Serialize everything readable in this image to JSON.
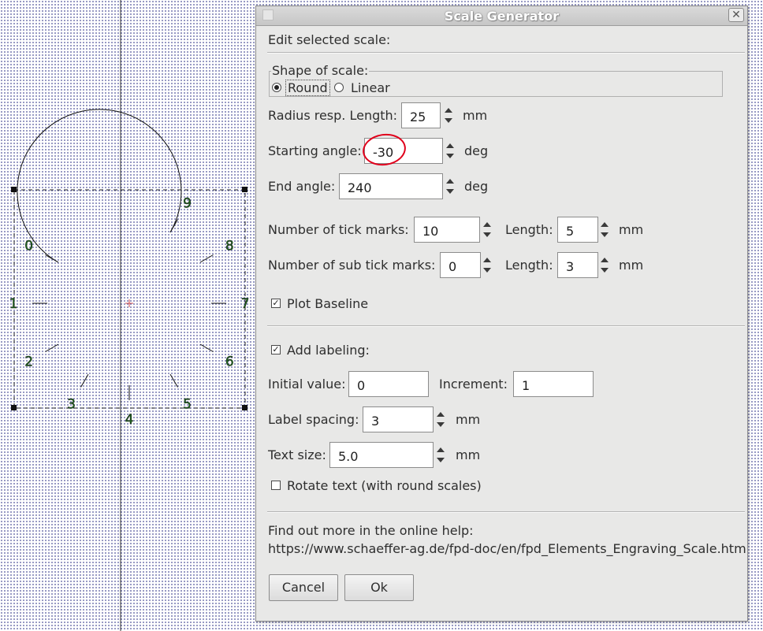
{
  "dialog": {
    "title": "Scale Generator",
    "heading": "Edit selected scale:",
    "shape": {
      "group_label": "Shape of scale:",
      "options": [
        "Round",
        "Linear"
      ],
      "selected": "Round"
    },
    "radius": {
      "label": "Radius resp. Length:",
      "value": "25",
      "unit": "mm"
    },
    "start_angle": {
      "label": "Starting angle:",
      "value": "-30",
      "unit": "deg"
    },
    "end_angle": {
      "label": "End angle:",
      "value": "240",
      "unit": "deg"
    },
    "ticks": {
      "label": "Number of tick marks:",
      "value": "10",
      "length_label": "Length:",
      "length_value": "5",
      "unit": "mm"
    },
    "sub_ticks": {
      "label": "Number of sub tick marks:",
      "value": "0",
      "length_label": "Length:",
      "length_value": "3",
      "unit": "mm"
    },
    "plot_baseline": {
      "label": "Plot Baseline",
      "checked": true
    },
    "labeling": {
      "label": "Add labeling:",
      "checked": true,
      "initial_label": "Initial value:",
      "initial_value": "0",
      "increment_label": "Increment:",
      "increment_value": "1",
      "spacing_label": "Label spacing:",
      "spacing_value": "3",
      "spacing_unit": "mm",
      "text_size_label": "Text size:",
      "text_size_value": "5.0",
      "text_size_unit": "mm",
      "rotate_label": "Rotate text (with round scales)",
      "rotate_checked": false
    },
    "help": {
      "text": "Find out more in the online help:",
      "url": "https://www.schaeffer-ag.de/fpd-doc/en/fpd_Elements_Engraving_Scale.htm"
    },
    "buttons": {
      "cancel": "Cancel",
      "ok": "Ok"
    }
  },
  "canvas": {
    "scale_labels": [
      "0",
      "1",
      "2",
      "3",
      "4",
      "5",
      "6",
      "7",
      "8",
      "9"
    ]
  }
}
